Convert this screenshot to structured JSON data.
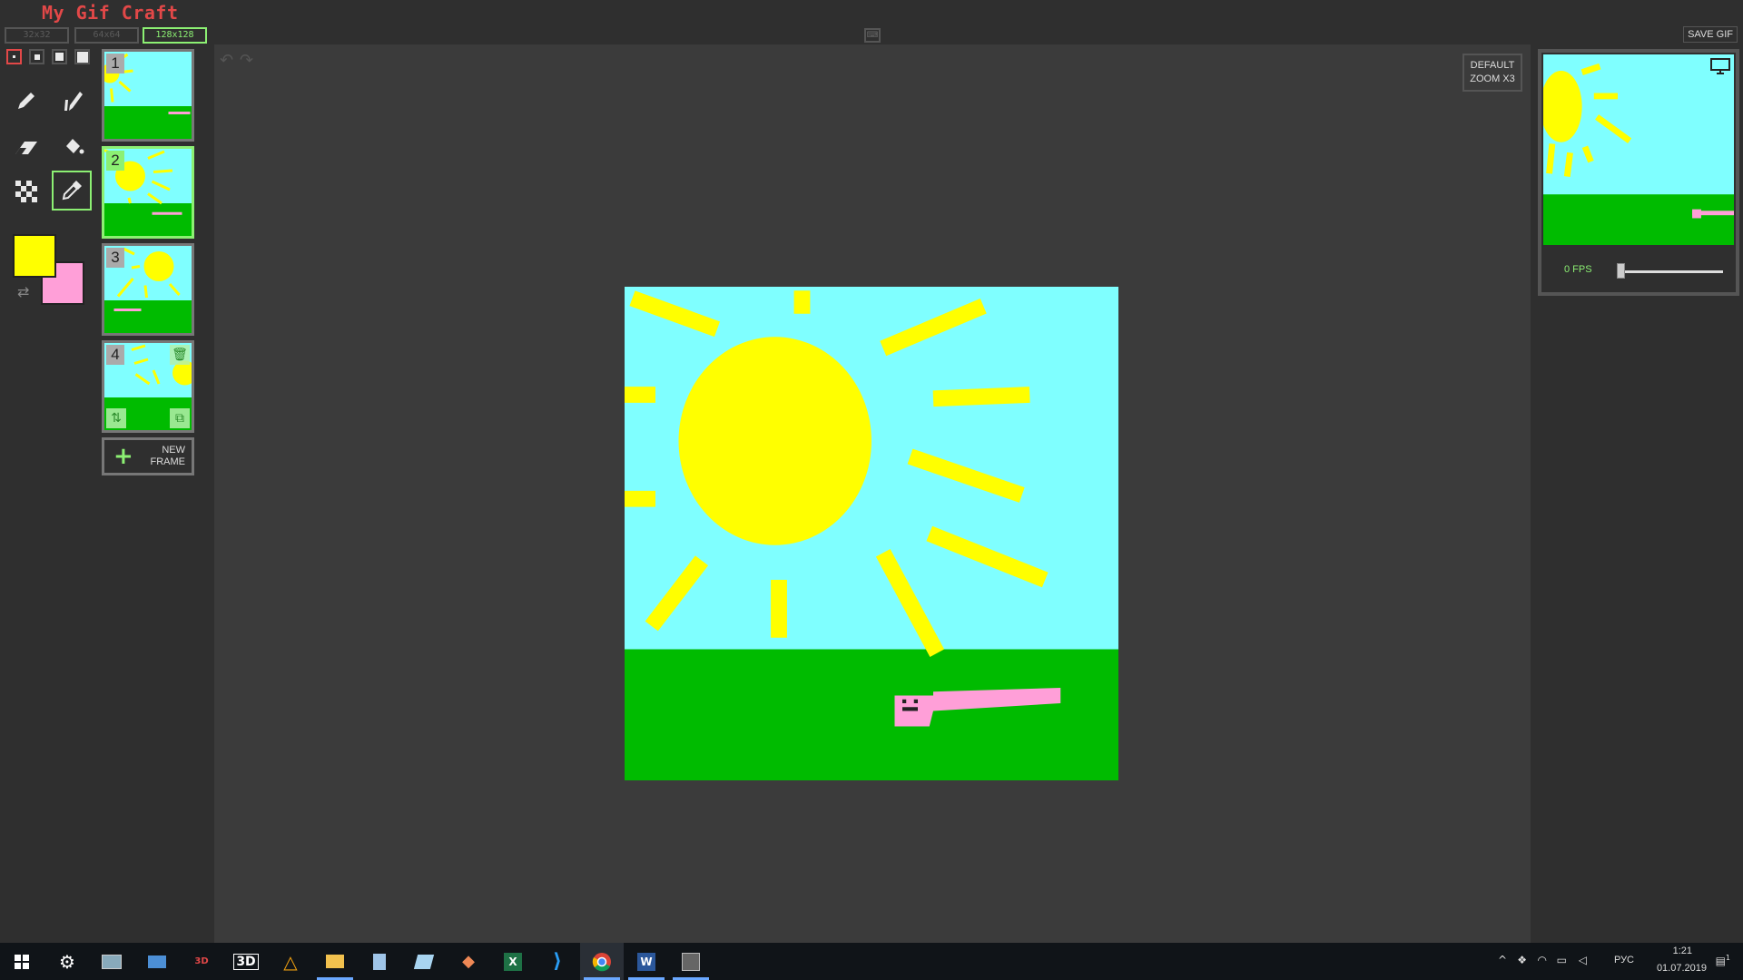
{
  "app": {
    "title": "My Gif Craft"
  },
  "resolutions": [
    {
      "label": "32x32",
      "active": false
    },
    {
      "label": "64x64",
      "active": false
    },
    {
      "label": "128x128",
      "active": true
    }
  ],
  "toolbar": {
    "save_gif": "SAVE GIF",
    "keyboard_icon": "keyboard-icon"
  },
  "tools": {
    "pen_sizes": [
      1,
      2,
      3,
      4
    ],
    "items": [
      "pencil-icon",
      "mirror-pen-icon",
      "eraser-icon",
      "paint-bucket-icon",
      "dither-icon",
      "color-picker-icon"
    ],
    "active_tool": "color-picker-icon"
  },
  "colors": {
    "primary": "#ffff00",
    "secondary": "#ff9fd8",
    "accent": "#8cf073",
    "danger": "#e24848",
    "sky": "#7fffff",
    "grass": "#00bb00"
  },
  "frames": {
    "items": [
      {
        "number": "1"
      },
      {
        "number": "2"
      },
      {
        "number": "3"
      },
      {
        "number": "4"
      }
    ],
    "selected": "2",
    "new_frame_line1": "NEW",
    "new_frame_line2": "FRAME"
  },
  "workspace": {
    "zoom_line1": "DEFAULT",
    "zoom_line2": "ZOOM X3"
  },
  "preview": {
    "fps_label": "0 FPS",
    "fps_value": 0
  },
  "taskbar": {
    "lang": "РУС",
    "time": "1:21",
    "date": "01.07.2019",
    "notifications": "1"
  }
}
